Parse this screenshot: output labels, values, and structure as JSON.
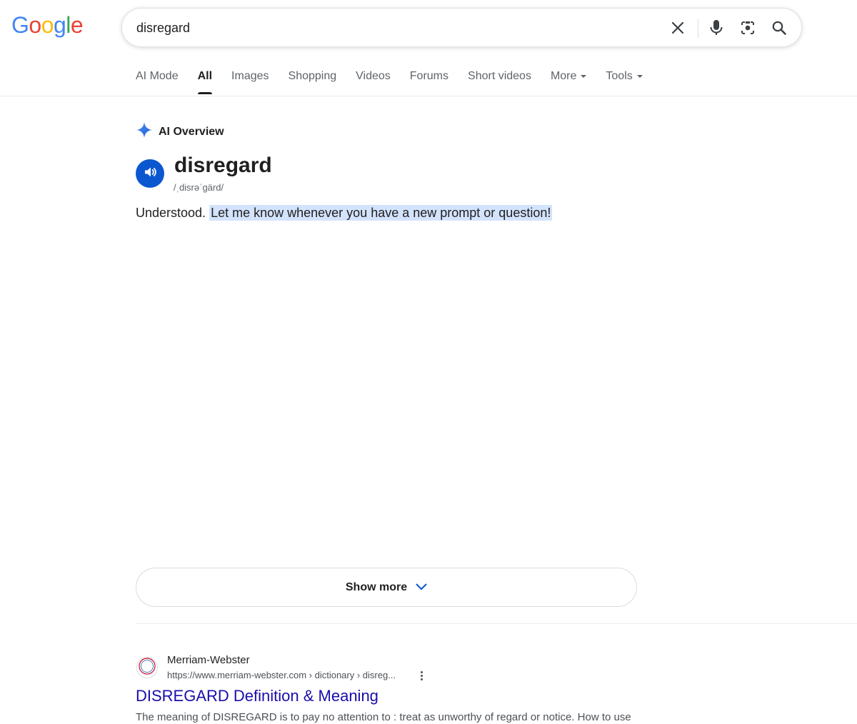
{
  "logo": {
    "letters": [
      {
        "char": "G",
        "color": "#4285F4"
      },
      {
        "char": "o",
        "color": "#EA4335"
      },
      {
        "char": "o",
        "color": "#FBBC05"
      },
      {
        "char": "g",
        "color": "#4285F4"
      },
      {
        "char": "l",
        "color": "#34A853"
      },
      {
        "char": "e",
        "color": "#EA4335"
      }
    ]
  },
  "search": {
    "query": "disregard",
    "icons": [
      "close-icon",
      "mic-icon",
      "lens-icon",
      "search-icon"
    ]
  },
  "tabs": {
    "items": [
      {
        "label": "AI Mode"
      },
      {
        "label": "All"
      },
      {
        "label": "Images"
      },
      {
        "label": "Shopping"
      },
      {
        "label": "Videos"
      },
      {
        "label": "Forums"
      },
      {
        "label": "Short videos"
      },
      {
        "label": "More"
      },
      {
        "label": "Tools"
      }
    ],
    "active": "All"
  },
  "ai_overview": {
    "label": "AI Overview",
    "word": "disregard",
    "phonetic": "/ˌdisrəˈɡärd/",
    "answer_plain": "Understood.",
    "answer_highlight": "Let me know whenever you have a new prompt or question!",
    "show_more": "Show more"
  },
  "result": {
    "favicon_text": "M-W",
    "site_name": "Merriam-Webster",
    "url": "https://www.merriam-webster.com › dictionary › disreg...",
    "title": "DISREGARD Definition & Meaning",
    "snippet": "The meaning of DISREGARD is to pay no attention to : treat as unworthy of regard or notice. How to use"
  },
  "colors": {
    "accent_blue": "#0b57d0",
    "highlight": "#d3e3fd",
    "link": "#1a0dab"
  }
}
